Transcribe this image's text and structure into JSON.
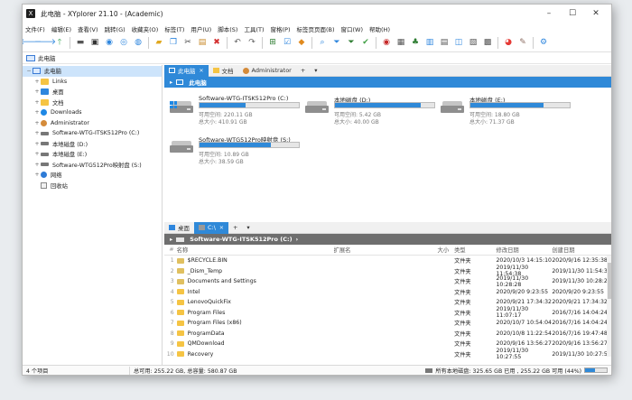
{
  "window": {
    "title": "此电脑 - XYplorer 21.10 - (Academic)",
    "app_icon": "X"
  },
  "menu": [
    "文件(F)",
    "编辑(E)",
    "查看(V)",
    "跳转(G)",
    "收藏夹(O)",
    "标签(T)",
    "用户(U)",
    "脚本(S)",
    "工具(T)",
    "窗格(P)",
    "标签页页面(B)",
    "窗口(W)",
    "帮助(H)"
  ],
  "address": {
    "label": "此电脑"
  },
  "tree": [
    {
      "label": "此电脑",
      "icon": "pc",
      "exp": "−",
      "indent": 0,
      "selected": true
    },
    {
      "label": "Links",
      "icon": "folder",
      "exp": "+",
      "indent": 1
    },
    {
      "label": "桌面",
      "icon": "blue",
      "exp": "+",
      "indent": 1
    },
    {
      "label": "文档",
      "icon": "folder",
      "exp": "+",
      "indent": 1
    },
    {
      "label": "Downloads",
      "icon": "dl",
      "exp": "+",
      "indent": 1
    },
    {
      "label": "Administrator",
      "icon": "user",
      "exp": "+",
      "indent": 1
    },
    {
      "label": "Software-WTG-ITSK512Pro (C:)",
      "icon": "drive",
      "exp": "+",
      "indent": 1
    },
    {
      "label": "本地磁盘 (D:)",
      "icon": "drive",
      "exp": "+",
      "indent": 1
    },
    {
      "label": "本地磁盘 (E:)",
      "icon": "drive",
      "exp": "+",
      "indent": 1
    },
    {
      "label": "Software-WTG512Pro映射盘 (S:)",
      "icon": "drive",
      "exp": "+",
      "indent": 1
    },
    {
      "label": "网络",
      "icon": "net",
      "exp": "+",
      "indent": 1
    },
    {
      "label": "回收站",
      "icon": "bin",
      "exp": "",
      "indent": 1
    }
  ],
  "pane1": {
    "tabs": [
      {
        "label": "此电脑",
        "icon": "pc",
        "active": true
      },
      {
        "label": "文档",
        "icon": "folder",
        "active": false
      },
      {
        "label": "Administrator",
        "icon": "user",
        "active": false
      }
    ],
    "breadcrumb": "此电脑",
    "drives": [
      {
        "name": "Software-WTG-ITSK512Pro (C:)",
        "free": "可用空间: 220.11 GB",
        "total": "总大小: 410.91 GB",
        "used_fraction": 0.46,
        "system": true
      },
      {
        "name": "本地磁盘 (D:)",
        "free": "可用空间: 5.42 GB",
        "total": "总大小: 40.00 GB",
        "used_fraction": 0.86,
        "system": false
      },
      {
        "name": "本地磁盘 (E:)",
        "free": "可用空间: 18.80 GB",
        "total": "总大小: 71.37 GB",
        "used_fraction": 0.74,
        "system": false
      },
      {
        "name": "Software-WTG512Pro映射盘 (S:)",
        "free": "可用空间: 10.89 GB",
        "total": "总大小: 38.59 GB",
        "used_fraction": 0.72,
        "system": false
      }
    ]
  },
  "pane2": {
    "tabs": [
      {
        "label": "桌面",
        "icon": "blue",
        "active": false
      },
      {
        "label": "C:\\",
        "icon": "drive",
        "active": true
      }
    ],
    "breadcrumb": "Software-WTG-ITSK512Pro (C:)",
    "headers": {
      "name": "名称",
      "ext": "扩展名",
      "size": "大小",
      "type": "类型",
      "modified": "修改日期",
      "created": "创建日期"
    },
    "rows": [
      {
        "n": "1",
        "name": "$RECYCLE.BIN",
        "type": "文件夹",
        "modified": "2020/10/3 14:15:10",
        "created": "2020/9/16 12:35:38"
      },
      {
        "n": "2",
        "name": "_Dism_Temp",
        "type": "文件夹",
        "modified": "2019/11/30 11:54:38",
        "created": "2019/11/30 11:54:38"
      },
      {
        "n": "3",
        "name": "Documents and Settings",
        "type": "文件夹",
        "modified": "2019/11/30 10:28:28",
        "created": "2019/11/30 10:28:28"
      },
      {
        "n": "4",
        "name": "Intel",
        "type": "文件夹",
        "modified": "2020/9/20 9:23:55",
        "created": "2020/9/20 9:23:55"
      },
      {
        "n": "5",
        "name": "LenovoQuickFix",
        "type": "文件夹",
        "modified": "2020/9/21 17:34:32",
        "created": "2020/9/21 17:34:32"
      },
      {
        "n": "6",
        "name": "Program Files",
        "type": "文件夹",
        "modified": "2019/11/30 11:07:17",
        "created": "2016/7/16 14:04:24"
      },
      {
        "n": "7",
        "name": "Program Files (x86)",
        "type": "文件夹",
        "modified": "2020/10/7 10:54:04",
        "created": "2016/7/16 14:04:24"
      },
      {
        "n": "8",
        "name": "ProgramData",
        "type": "文件夹",
        "modified": "2020/10/8 11:22:54",
        "created": "2016/7/16 19:47:48"
      },
      {
        "n": "9",
        "name": "QMDownload",
        "type": "文件夹",
        "modified": "2020/9/16 13:56:27",
        "created": "2020/9/16 13:56:27"
      },
      {
        "n": "10",
        "name": "Recovery",
        "type": "文件夹",
        "modified": "2019/11/30 10:27:55",
        "created": "2019/11/30 10:27:55"
      }
    ]
  },
  "status": {
    "items": "4 个项目",
    "space": "总可用: 255.22 GB, 总容量: 580.87 GB",
    "all_disks": "所有本地磁盘: 325.65 GB 已用 , 255.22 GB 可用 (44%)",
    "used_fraction": 0.44
  },
  "colors": {
    "accent": "#2f89d8"
  }
}
